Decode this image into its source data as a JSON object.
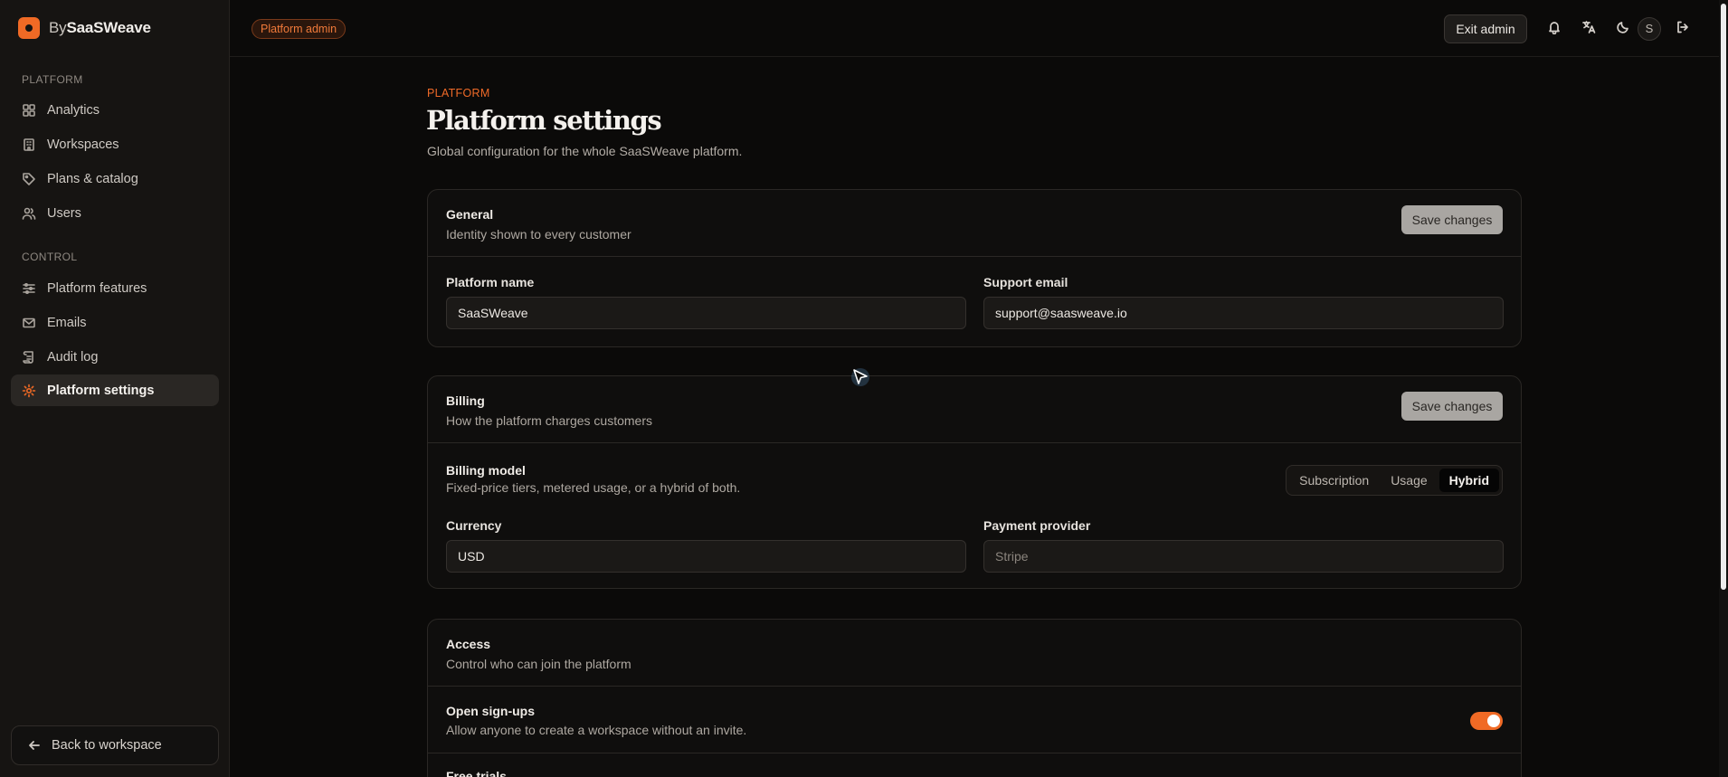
{
  "brand": {
    "prefix": "By",
    "name": "SaaSWeave"
  },
  "sidebar": {
    "sections": [
      {
        "label": "PLATFORM"
      },
      {
        "label": "CONTROL"
      }
    ],
    "items": [
      {
        "label": "Analytics",
        "icon": "grid-icon"
      },
      {
        "label": "Workspaces",
        "icon": "building-icon"
      },
      {
        "label": "Plans & catalog",
        "icon": "tag-icon"
      },
      {
        "label": "Users",
        "icon": "users-icon"
      },
      {
        "label": "Platform features",
        "icon": "sliders-icon"
      },
      {
        "label": "Emails",
        "icon": "mail-icon"
      },
      {
        "label": "Audit log",
        "icon": "scroll-icon"
      },
      {
        "label": "Platform settings",
        "icon": "gear-icon",
        "active": true
      }
    ],
    "back_label": "Back to workspace"
  },
  "topbar": {
    "badge": "Platform admin",
    "exit_label": "Exit admin",
    "avatar_initial": "S"
  },
  "page": {
    "eyebrow": "PLATFORM",
    "title": "Platform settings",
    "subtitle": "Global configuration for the whole SaaSWeave platform."
  },
  "general": {
    "title": "General",
    "desc": "Identity shown to every customer",
    "save_label": "Save changes",
    "platform_name_label": "Platform name",
    "platform_name_value": "SaaSWeave",
    "support_email_label": "Support email",
    "support_email_value": "support@saasweave.io"
  },
  "billing": {
    "title": "Billing",
    "desc": "How the platform charges customers",
    "save_label": "Save changes",
    "model_title": "Billing model",
    "model_desc": "Fixed-price tiers, metered usage, or a hybrid of both.",
    "model_options": [
      "Subscription",
      "Usage",
      "Hybrid"
    ],
    "model_selected": "Hybrid",
    "currency_label": "Currency",
    "currency_value": "USD",
    "provider_label": "Payment provider",
    "provider_placeholder": "Stripe"
  },
  "access": {
    "title": "Access",
    "desc": "Control who can join the platform",
    "signups_title": "Open sign-ups",
    "signups_desc": "Allow anyone to create a workspace without an invite.",
    "signups_enabled": true,
    "trials_title": "Free trials"
  },
  "colors": {
    "accent": "#f06a25",
    "background": "#0b0a09",
    "sidebar": "#161412"
  }
}
